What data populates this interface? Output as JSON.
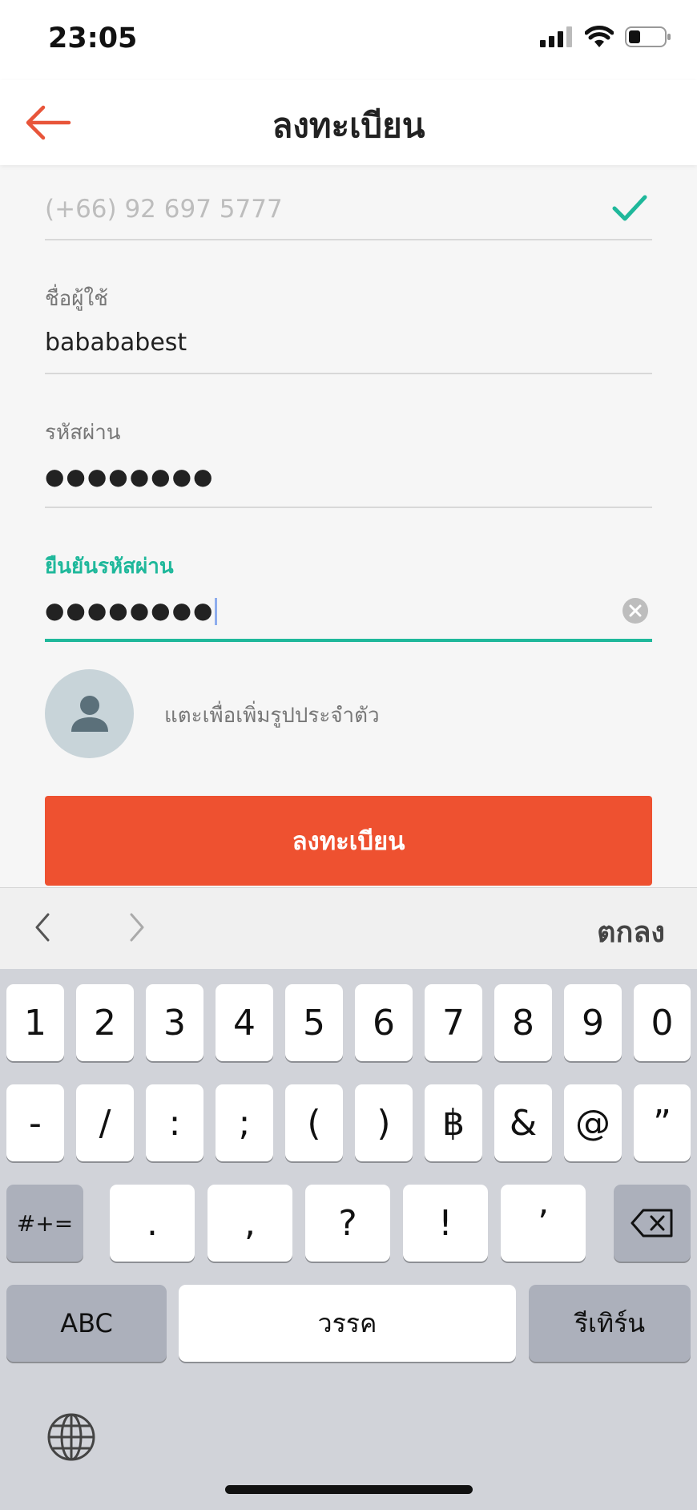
{
  "status_bar": {
    "time": "23:05"
  },
  "header": {
    "title": "ลงทะเบียน"
  },
  "form": {
    "phone": {
      "value": "(+66) 92 697 5777"
    },
    "username": {
      "label": "ชื่อผู้ใช้",
      "value": "babababest"
    },
    "password": {
      "label": "รหัสผ่าน",
      "value": "●●●●●●●●"
    },
    "confirm_password": {
      "label": "ยืนยันรหัสผ่าน",
      "value": "●●●●●●●●"
    },
    "avatar_hint": "แตะเพื่อเพิ่มรูปประจำตัว",
    "submit_label": "ลงทะเบียน"
  },
  "keyboard_toolbar": {
    "done_label": "ตกลง"
  },
  "keyboard": {
    "row1": [
      "1",
      "2",
      "3",
      "4",
      "5",
      "6",
      "7",
      "8",
      "9",
      "0"
    ],
    "row2": [
      "-",
      "/",
      ":",
      ";",
      "(",
      ")",
      "฿",
      "&",
      "@",
      "”"
    ],
    "row3_symbols": "#+=",
    "row3": [
      ".",
      ",",
      "?",
      "!",
      "’"
    ],
    "abc_label": "ABC",
    "space_label": "วรรค",
    "return_label": "รีเทิร์น"
  },
  "colors": {
    "accent": "#1fb89b",
    "brand": "#ee5130",
    "back_arrow": "#e8553a"
  },
  "icons": [
    "signal-icon",
    "wifi-icon",
    "battery-icon",
    "back-arrow-icon",
    "check-icon",
    "clear-icon",
    "person-icon",
    "chevron-left-icon",
    "chevron-right-icon",
    "backspace-icon",
    "globe-icon"
  ]
}
